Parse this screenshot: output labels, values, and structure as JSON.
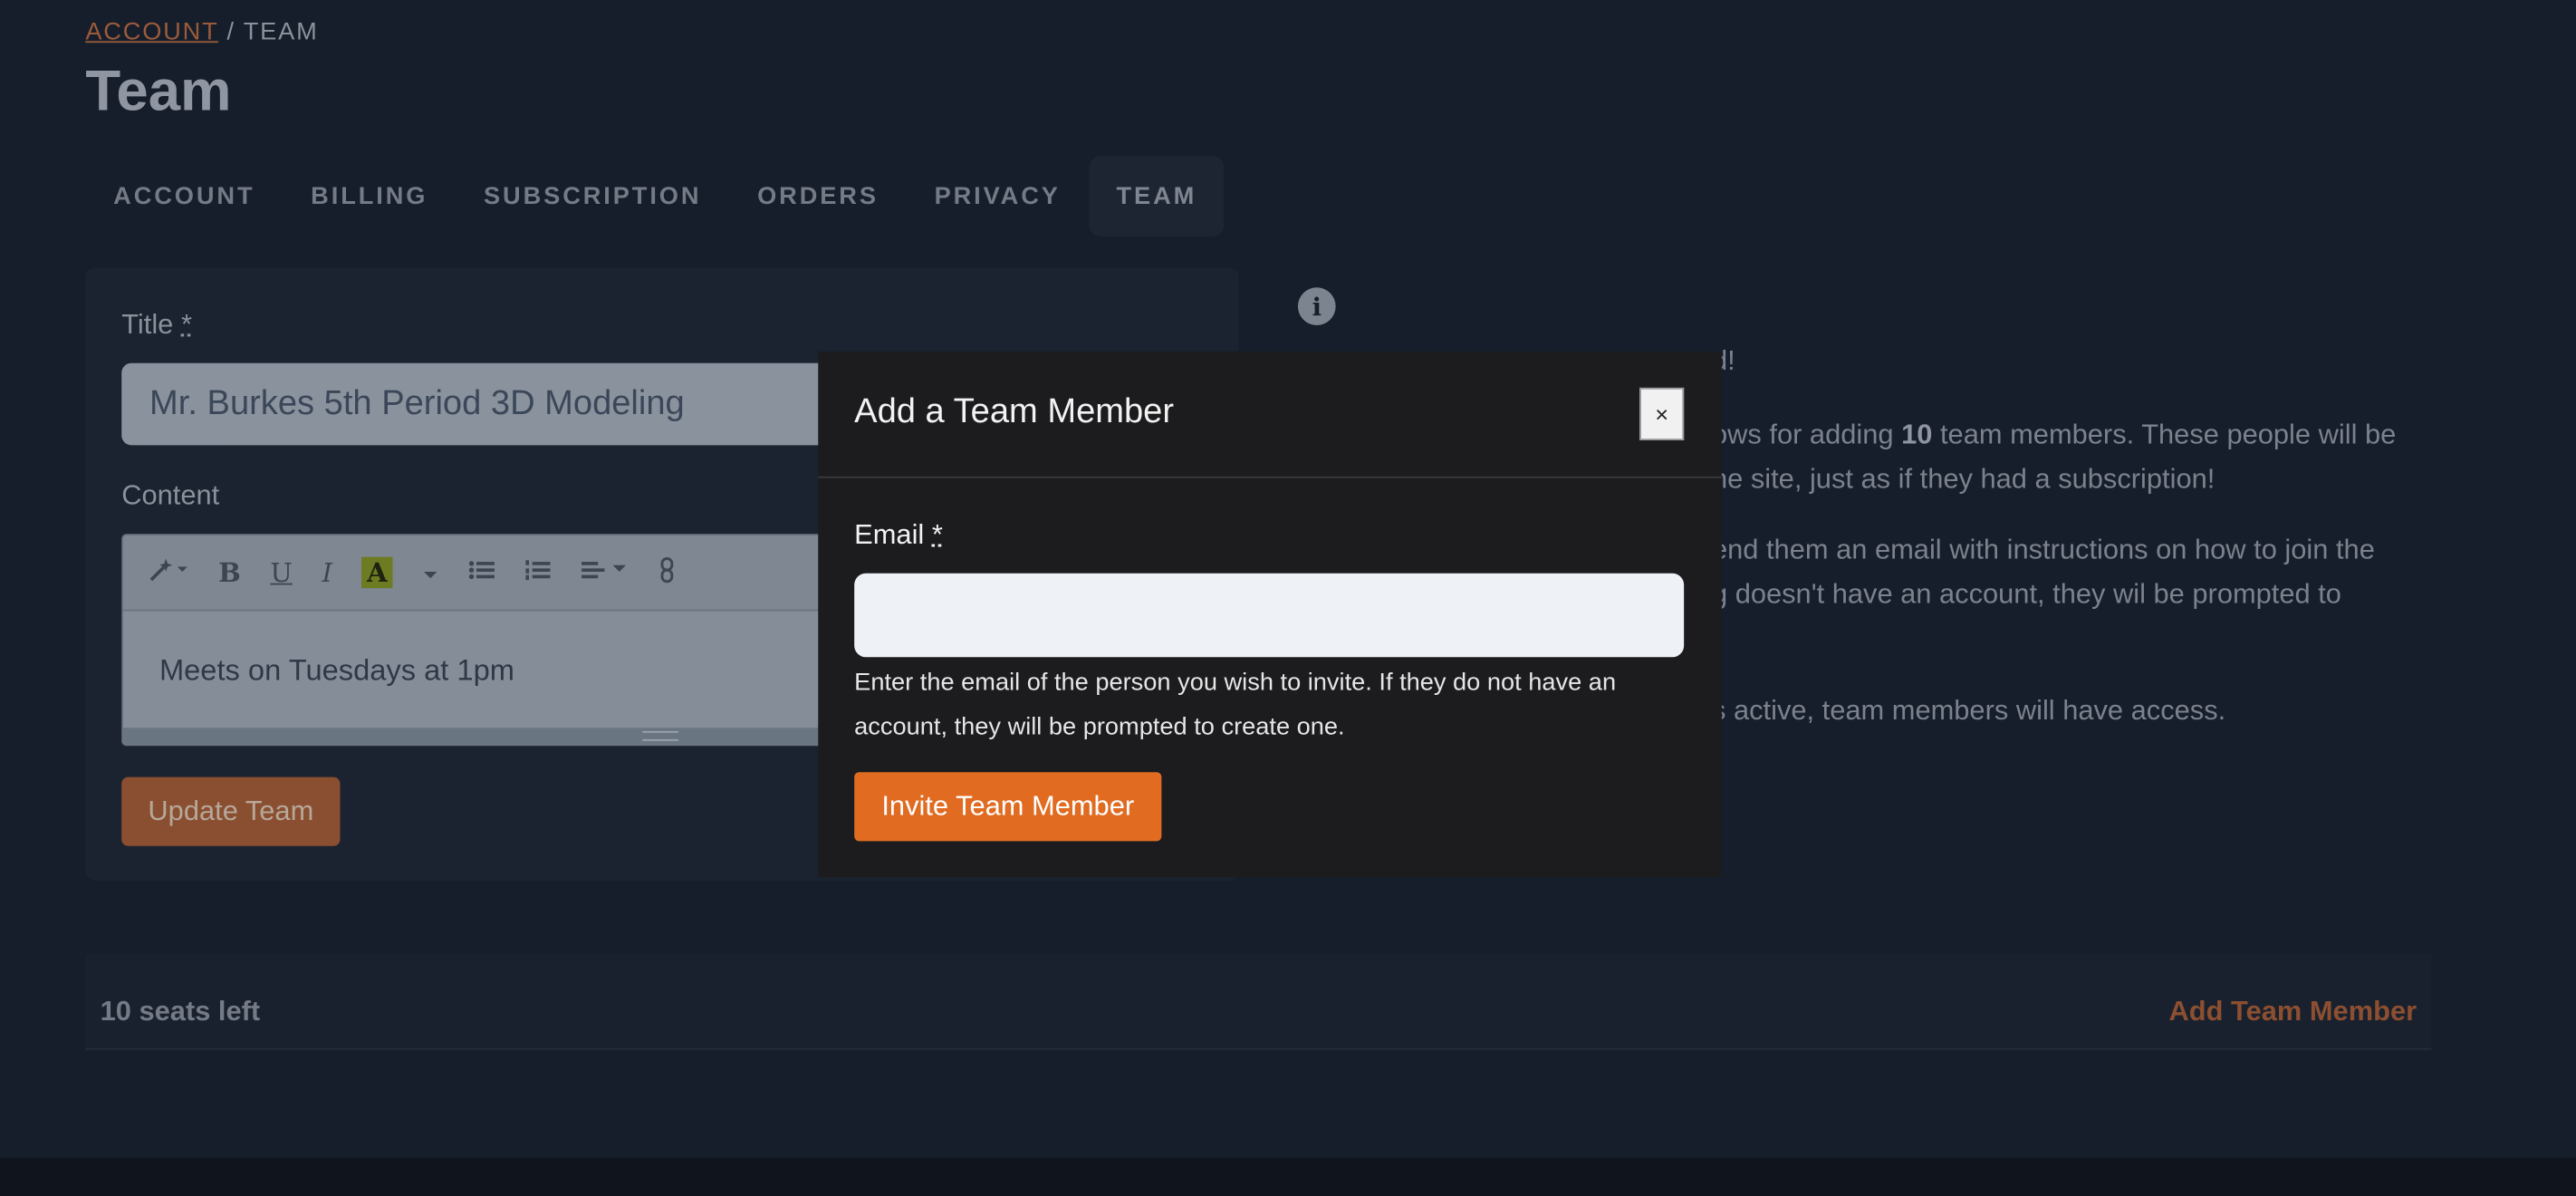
{
  "breadcrumb": {
    "link": "ACCOUNT",
    "separator": "/",
    "current": "TEAM"
  },
  "page": {
    "title": "Team"
  },
  "tabs": [
    {
      "label": "ACCOUNT"
    },
    {
      "label": "BILLING"
    },
    {
      "label": "SUBSCRIPTION"
    },
    {
      "label": "ORDERS"
    },
    {
      "label": "PRIVACY"
    },
    {
      "label": "TEAM",
      "active": true
    }
  ],
  "form": {
    "title_label": "Title",
    "required_mark": "*",
    "title_value": "Mr. Burkes 5th Period 3D Modeling",
    "content_label": "Content",
    "content_value": "Meets on Tuesdays at 1pm",
    "toolbar": {
      "bold": "B",
      "underline": "U",
      "italic": "I",
      "highlight": "A"
    },
    "update_label": "Update Team"
  },
  "info_panel": {
    "line1": "d!",
    "line2_pre": "ows for adding ",
    "line2_bold": "10",
    "line2_post": " team members. These people will be",
    "line3": "he site, just as if they had a subscription!",
    "line4": "end them an email with instructions on how to join the",
    "line5": "g doesn't have an account, they wil be prompted to",
    "line6": "s active, team members will have access."
  },
  "seats": {
    "text": "10 seats left",
    "add_label": "Add Team Member"
  },
  "modal": {
    "title": "Add a Team Member",
    "close_label": "×",
    "email_label": "Email",
    "required_mark": "*",
    "email_value": "",
    "help": "Enter the email of the person you wish to invite. If they do not have an account, they will be prompted to create one.",
    "invite_label": "Invite Team Member"
  },
  "colors": {
    "accent": "#e06b21",
    "accent_dimmed": "#8c4f30",
    "page_bg": "#171e2b",
    "modal_bg": "#1c1c1f"
  }
}
